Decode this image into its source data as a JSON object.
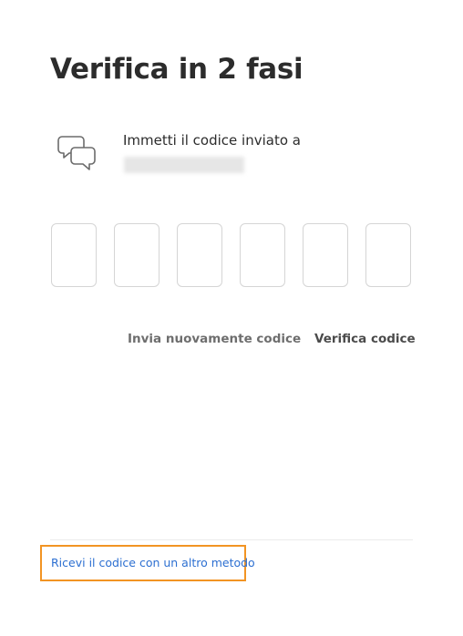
{
  "page": {
    "title": "Verifica in 2 fasi"
  },
  "message": {
    "icon": "chat-bubbles-icon",
    "instruction": "Immetti il codice inviato a"
  },
  "code_inputs": [
    "",
    "",
    "",
    "",
    "",
    ""
  ],
  "actions": {
    "resend_label": "Invia nuovamente codice",
    "verify_label": "Verifica codice"
  },
  "footer": {
    "alt_method_label": "Ricevi il codice con un altro metodo",
    "highlight_color": "#f29423",
    "link_color": "#2c6fd1"
  }
}
